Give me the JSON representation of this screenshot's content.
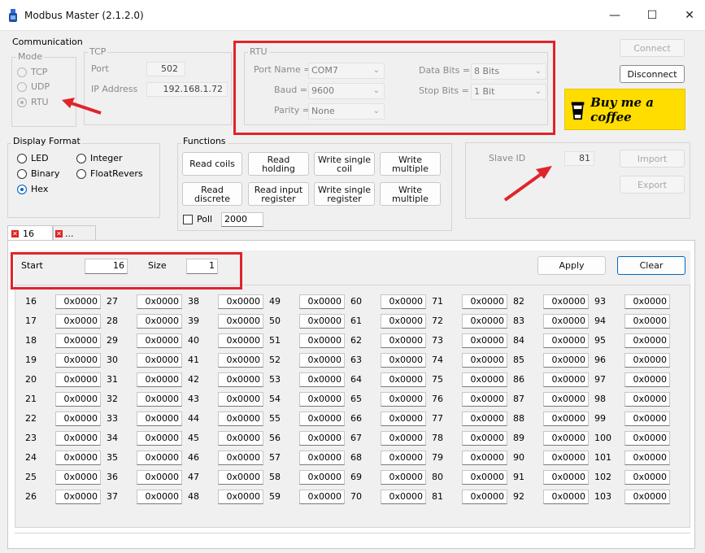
{
  "window": {
    "title": "Modbus Master (2.1.2.0)",
    "controls": [
      "—",
      "☐",
      "✕"
    ]
  },
  "communication": {
    "label": "Communication",
    "mode": {
      "label": "Mode",
      "options": [
        "TCP",
        "UDP",
        "RTU"
      ],
      "selected": "RTU"
    },
    "tcp": {
      "label": "TCP",
      "port_label": "Port",
      "port_value": "502",
      "ip_label": "IP Address",
      "ip_value": "192.168.1.72"
    },
    "rtu": {
      "label": "RTU",
      "port_name_label": "Port Name =",
      "port_name_value": "COM7",
      "baud_label": "Baud =",
      "baud_value": "9600",
      "parity_label": "Parity =",
      "parity_value": "None",
      "data_bits_label": "Data Bits =",
      "data_bits_value": "8 Bits",
      "stop_bits_label": "Stop Bits =",
      "stop_bits_value": "1 Bit"
    }
  },
  "connection": {
    "connect_label": "Connect",
    "disconnect_label": "Disconnect",
    "coffee_label": "Buy me a coffee"
  },
  "display_format": {
    "label": "Display Format",
    "options": [
      "LED",
      "Binary",
      "Hex",
      "Integer",
      "FloatRevers"
    ],
    "selected": "Hex"
  },
  "functions": {
    "label": "Functions",
    "buttons": [
      [
        "Read coils"
      ],
      [
        "Read",
        "holding"
      ],
      [
        "Write single",
        "coil"
      ],
      [
        "Write",
        "multiple"
      ],
      [
        "Read",
        "discrete"
      ],
      [
        "Read input",
        "register"
      ],
      [
        "Write single",
        "register"
      ],
      [
        "Write",
        "multiple"
      ]
    ],
    "poll_label": "Poll",
    "poll_value": "2000"
  },
  "slave": {
    "label": "Slave ID",
    "value": "81",
    "import_label": "Import",
    "export_label": "Export"
  },
  "tabs": [
    {
      "label": "16"
    },
    {
      "label": "..."
    }
  ],
  "register_panel": {
    "start_label": "Start",
    "start_value": "16",
    "size_label": "Size",
    "size_value": "1",
    "apply_label": "Apply",
    "clear_label": "Clear"
  },
  "registers": {
    "columns": [
      [
        16,
        17,
        18,
        19,
        20,
        21,
        22,
        23,
        24,
        25,
        26
      ],
      [
        27,
        28,
        29,
        30,
        31,
        32,
        33,
        34,
        35,
        36,
        37
      ],
      [
        38,
        39,
        40,
        41,
        42,
        43,
        44,
        45,
        46,
        47,
        48
      ],
      [
        49,
        50,
        51,
        52,
        53,
        54,
        55,
        56,
        57,
        58,
        59
      ],
      [
        60,
        61,
        62,
        63,
        64,
        65,
        66,
        67,
        68,
        69,
        70
      ],
      [
        71,
        72,
        73,
        74,
        75,
        76,
        77,
        78,
        79,
        80,
        81
      ],
      [
        82,
        83,
        84,
        85,
        86,
        87,
        88,
        89,
        90,
        91,
        92
      ],
      [
        93,
        94,
        95,
        96,
        97,
        98,
        99,
        100,
        101,
        102,
        103
      ]
    ],
    "value": "0x0000"
  },
  "colors": {
    "annotation_red": "#e0242b",
    "accent": "#0067c0",
    "coffee_yellow": "#ffdd00"
  }
}
